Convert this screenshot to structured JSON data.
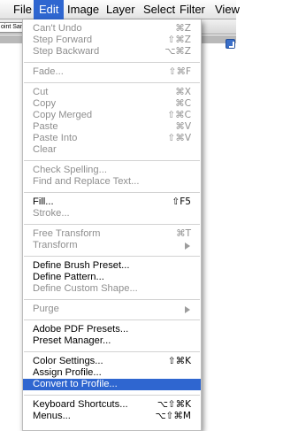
{
  "menubar": {
    "items": [
      "File",
      "Edit",
      "Image",
      "Layer",
      "Select",
      "Filter",
      "View"
    ]
  },
  "options_bar": {
    "field_text": "oint Samp"
  },
  "edit_menu": {
    "groups": [
      [
        {
          "label": "Can't Undo",
          "shortcut": "⌘Z",
          "state": "disabled"
        },
        {
          "label": "Step Forward",
          "shortcut": "⇧⌘Z",
          "state": "disabled"
        },
        {
          "label": "Step Backward",
          "shortcut": "⌥⌘Z",
          "state": "disabled"
        }
      ],
      [
        {
          "label": "Fade...",
          "shortcut": "⇧⌘F",
          "state": "disabled"
        }
      ],
      [
        {
          "label": "Cut",
          "shortcut": "⌘X",
          "state": "disabled"
        },
        {
          "label": "Copy",
          "shortcut": "⌘C",
          "state": "disabled"
        },
        {
          "label": "Copy Merged",
          "shortcut": "⇧⌘C",
          "state": "disabled"
        },
        {
          "label": "Paste",
          "shortcut": "⌘V",
          "state": "disabled"
        },
        {
          "label": "Paste Into",
          "shortcut": "⇧⌘V",
          "state": "disabled"
        },
        {
          "label": "Clear",
          "shortcut": "",
          "state": "disabled"
        }
      ],
      [
        {
          "label": "Check Spelling...",
          "shortcut": "",
          "state": "disabled"
        },
        {
          "label": "Find and Replace Text...",
          "shortcut": "",
          "state": "disabled"
        }
      ],
      [
        {
          "label": "Fill...",
          "shortcut": "⇧F5",
          "state": "enabled"
        },
        {
          "label": "Stroke...",
          "shortcut": "",
          "state": "disabled"
        }
      ],
      [
        {
          "label": "Free Transform",
          "shortcut": "⌘T",
          "state": "disabled"
        },
        {
          "label": "Transform",
          "shortcut": "",
          "state": "disabled",
          "submenu": true
        }
      ],
      [
        {
          "label": "Define Brush Preset...",
          "shortcut": "",
          "state": "enabled"
        },
        {
          "label": "Define Pattern...",
          "shortcut": "",
          "state": "enabled"
        },
        {
          "label": "Define Custom Shape...",
          "shortcut": "",
          "state": "disabled"
        }
      ],
      [
        {
          "label": "Purge",
          "shortcut": "",
          "state": "disabled",
          "submenu": true
        }
      ],
      [
        {
          "label": "Adobe PDF Presets...",
          "shortcut": "",
          "state": "enabled"
        },
        {
          "label": "Preset Manager...",
          "shortcut": "",
          "state": "enabled"
        }
      ],
      [
        {
          "label": "Color Settings...",
          "shortcut": "⇧⌘K",
          "state": "enabled"
        },
        {
          "label": "Assign Profile...",
          "shortcut": "",
          "state": "enabled"
        },
        {
          "label": "Convert to Profile...",
          "shortcut": "",
          "state": "highlighted"
        }
      ],
      [
        {
          "label": "Keyboard Shortcuts...",
          "shortcut": "⌥⇧⌘K",
          "state": "enabled"
        },
        {
          "label": "Menus...",
          "shortcut": "⌥⇧⌘M",
          "state": "enabled"
        }
      ]
    ]
  },
  "colors": {
    "highlight": "#2f66d0",
    "disabled_text": "#8f8f8f"
  }
}
